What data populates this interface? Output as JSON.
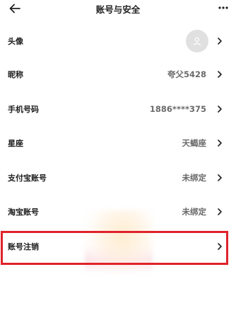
{
  "header": {
    "title": "账号与安全"
  },
  "rows": [
    {
      "label": "头像",
      "value": ""
    },
    {
      "label": "昵称",
      "value": "夸父5428"
    },
    {
      "label": "手机号码",
      "value": "1886****375"
    },
    {
      "label": "星座",
      "value": "天蝎座"
    },
    {
      "label": "支付宝账号",
      "value": "未绑定"
    },
    {
      "label": "淘宝账号",
      "value": "未绑定"
    },
    {
      "label": "账号注销",
      "value": ""
    }
  ],
  "icons": {
    "back": "back-arrow-icon",
    "more": "more-icon",
    "chevron": "chevron-right-icon",
    "avatar": "user-icon"
  },
  "colors": {
    "highlight_border": "#e0222a",
    "avatar_bg": "#e0e0e0"
  }
}
